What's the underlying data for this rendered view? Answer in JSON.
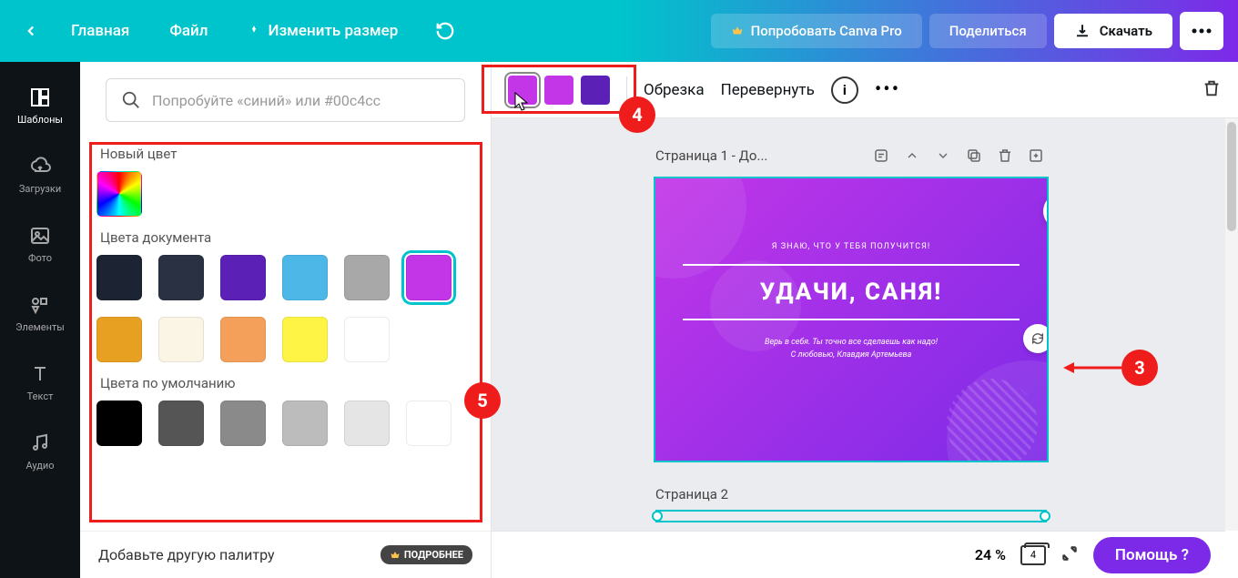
{
  "header": {
    "home": "Главная",
    "file": "Файл",
    "resize": "Изменить размер",
    "try_pro": "Попробовать Canva Pro",
    "share": "Поделиться",
    "download": "Скачать"
  },
  "nav": {
    "templates": "Шаблоны",
    "uploads": "Загрузки",
    "photos": "Фото",
    "elements": "Элементы",
    "text": "Текст",
    "audio": "Аудио"
  },
  "panel": {
    "search_placeholder": "Попробуйте «синий» или #00c4cc",
    "new_color": "Новый цвет",
    "doc_colors": "Цвета документа",
    "default_colors": "Цвета по умолчанию",
    "add_palette": "Добавьте другую палитру",
    "more": "ПОДРОБНЕЕ",
    "doc_swatches": [
      "#1c2332",
      "#2a3142",
      "#5b21b6",
      "#4db8e8",
      "#a8a8a8",
      "#c236e8",
      "#e8a023",
      "#faf5e4",
      "#f5a05a",
      "#fef445",
      "#ffffff"
    ],
    "default_swatches": [
      "#000000",
      "#555555",
      "#8a8a8a",
      "#bcbcbc",
      "#e5e5e5",
      "#ffffff"
    ]
  },
  "toolbar": {
    "colors": [
      "#c236e8",
      "#c236e8",
      "#5b21b6"
    ],
    "crop": "Обрезка",
    "flip": "Перевернуть"
  },
  "canvas": {
    "page1_title": "Страница 1 - До...",
    "page2_title": "Страница 2",
    "card": {
      "top_line": "Я ЗНАЮ, ЧТО У ТЕБЯ ПОЛУЧИТСЯ!",
      "main": "УДАЧИ, САНЯ!",
      "sub1": "Верь в себя. Ты точно все сделаешь как надо!",
      "sub2": "С любовью, Клавдия Артемьева"
    }
  },
  "bottom": {
    "zoom": "24 %",
    "page_count": "4",
    "help": "Помощь  ?"
  },
  "annotations": {
    "n3": "3",
    "n4": "4",
    "n5": "5"
  }
}
